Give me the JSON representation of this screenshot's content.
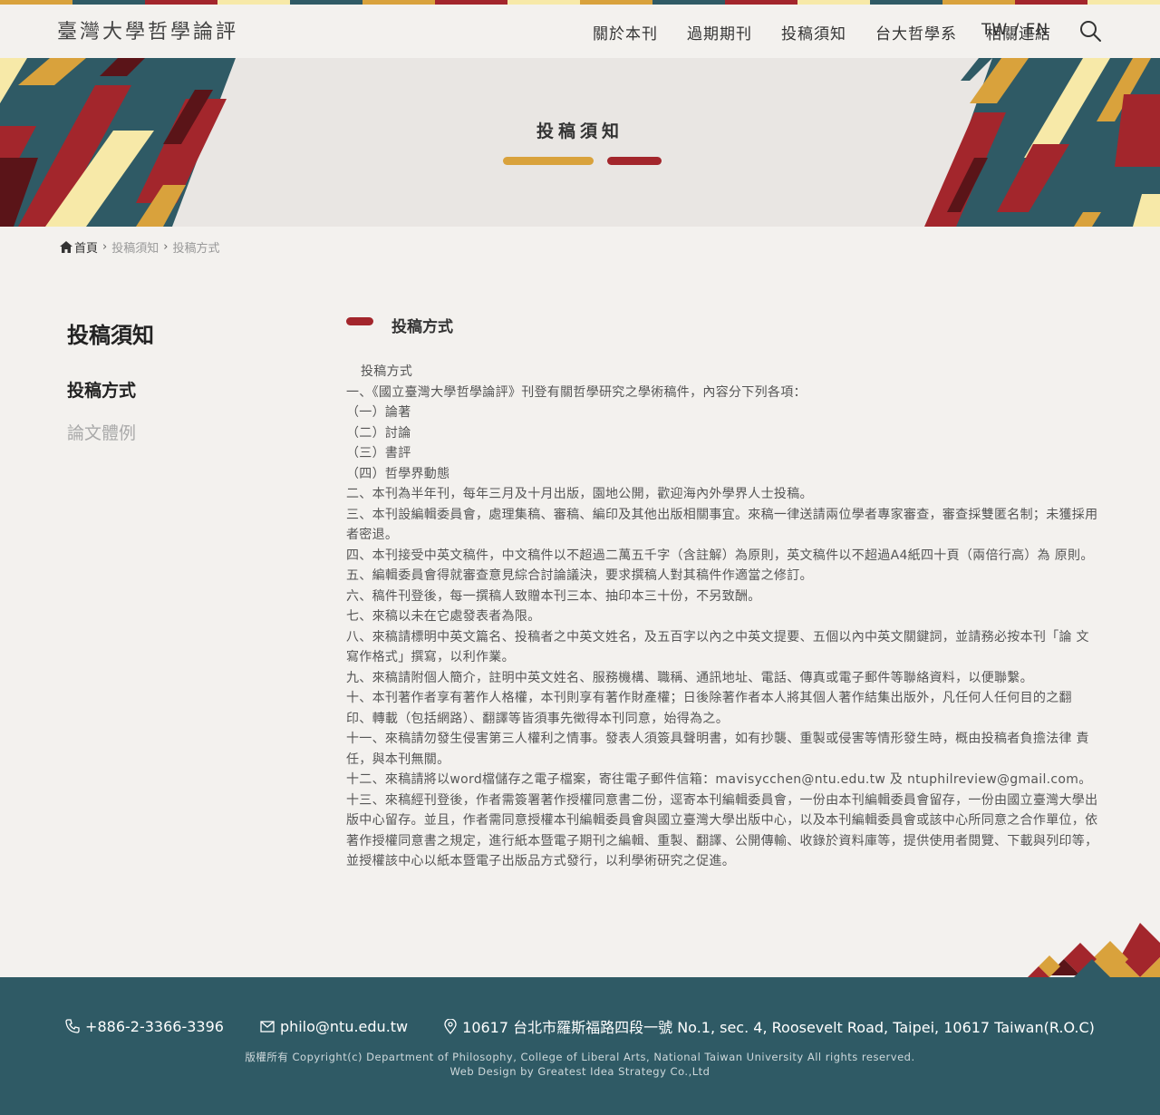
{
  "header": {
    "logo": "臺灣大學哲學論評",
    "nav": [
      "關於本刊",
      "過期期刊",
      "投稿須知",
      "台大哲學系",
      "相關連結"
    ],
    "lang": "TW / EN",
    "icons": {
      "search": "search-icon"
    }
  },
  "colors": {
    "teal": "#2f5a65",
    "red": "#a3262c",
    "gold": "#d9a23c",
    "cream": "#f7e9a8",
    "darkred": "#5a1418"
  },
  "banner": {
    "title": "投稿須知"
  },
  "breadcrumb": {
    "home": "首頁",
    "level1": "投稿須知",
    "level2": "投稿方式"
  },
  "sidebar": {
    "title": "投稿須知",
    "items": [
      {
        "label": "投稿方式",
        "active": true
      },
      {
        "label": "論文體例",
        "active": false
      }
    ]
  },
  "content": {
    "title": "投稿方式",
    "subtitle": "投稿方式",
    "paragraphs": [
      "一、《國立臺灣大學哲學論評》刊登有關哲學研究之學術稿件，內容分下列各項：",
      "（一）論著",
      "（二）討論",
      "（三）書評",
      "（四）哲學界動態",
      "二、本刊為半年刊，每年三月及十月出版，園地公開，歡迎海內外學界人士投稿。",
      "三、本刊設編輯委員會，處理集稿、審稿、編印及其他出版相關事宜。來稿一律送請兩位學者專家審查，審查採雙匿名制；未獲採用者密退。",
      "四、本刊接受中英文稿件，中文稿件以不超過二萬五千字（含註解）為原則，英文稿件以不超過A4紙四十頁（兩倍行高）為 原則。",
      "五、編輯委員會得就審查意見綜合討論議決，要求撰稿人對其稿件作適當之修訂。",
      "六、稿件刊登後，每一撰稿人致贈本刊三本、抽印本三十份，不另致酬。",
      "七、來稿以未在它處發表者為限。",
      "八、來稿請標明中英文篇名、投稿者之中英文姓名，及五百字以內之中英文提要、五個以內中英文關鍵詞，並請務必按本刊「論 文寫作格式」撰寫，以利作業。",
      "九、來稿請附個人簡介，註明中英文姓名、服務機構、職稱、通訊地址、電話、傳真或電子郵件等聯絡資料，以便聯繫。",
      "十、本刊著作者享有著作人格權，本刊則享有著作財產權；日後除著作者本人將其個人著作結集出版外，凡任何人任何目的之翻 印、轉載（包括網路）、翻譯等皆須事先徵得本刊同意，始得為之。",
      "十一、來稿請勿發生侵害第三人權利之情事。發表人須簽具聲明書，如有抄襲、重製或侵害等情形發生時，概由投稿者負擔法律 責任，與本刊無關。",
      "十二、來稿請將以word檔儲存之電子檔案，寄往電子郵件信箱：mavisycchen@ntu.edu.tw 及 ntuphilreview@gmail.com。",
      "十三、來稿經刊登後，作者需簽署著作授權同意書二份，逕寄本刊編輯委員會，一份由本刊編輯委員會留存，一份由國立臺灣大學出版中心留存。並且，作者需同意授權本刊編輯委員會與國立臺灣大學出版中心，以及本刊編輯委員會或該中心所同意之合作單位，依著作授權同意書之規定，進行紙本暨電子期刊之編輯、重製、翻譯、公開傳輸、收錄於資料庫等，提供使用者閱覽、下載與列印等，並授權該中心以紙本暨電子出版品方式發行，以利學術研究之促進。"
    ]
  },
  "footer": {
    "phone": "+886-2-3366-3396",
    "email": "philo@ntu.edu.tw",
    "address": "10617 台北市羅斯福路四段一號 No.1, sec. 4, Roosevelt Road, Taipei, 10617 Taiwan(R.O.C)",
    "copyright": "版權所有 Copyright(c) Department of Philosophy, College of Liberal Arts, National Taiwan University All rights reserved.",
    "design": "Web Design by Greatest Idea Strategy Co.,Ltd"
  }
}
